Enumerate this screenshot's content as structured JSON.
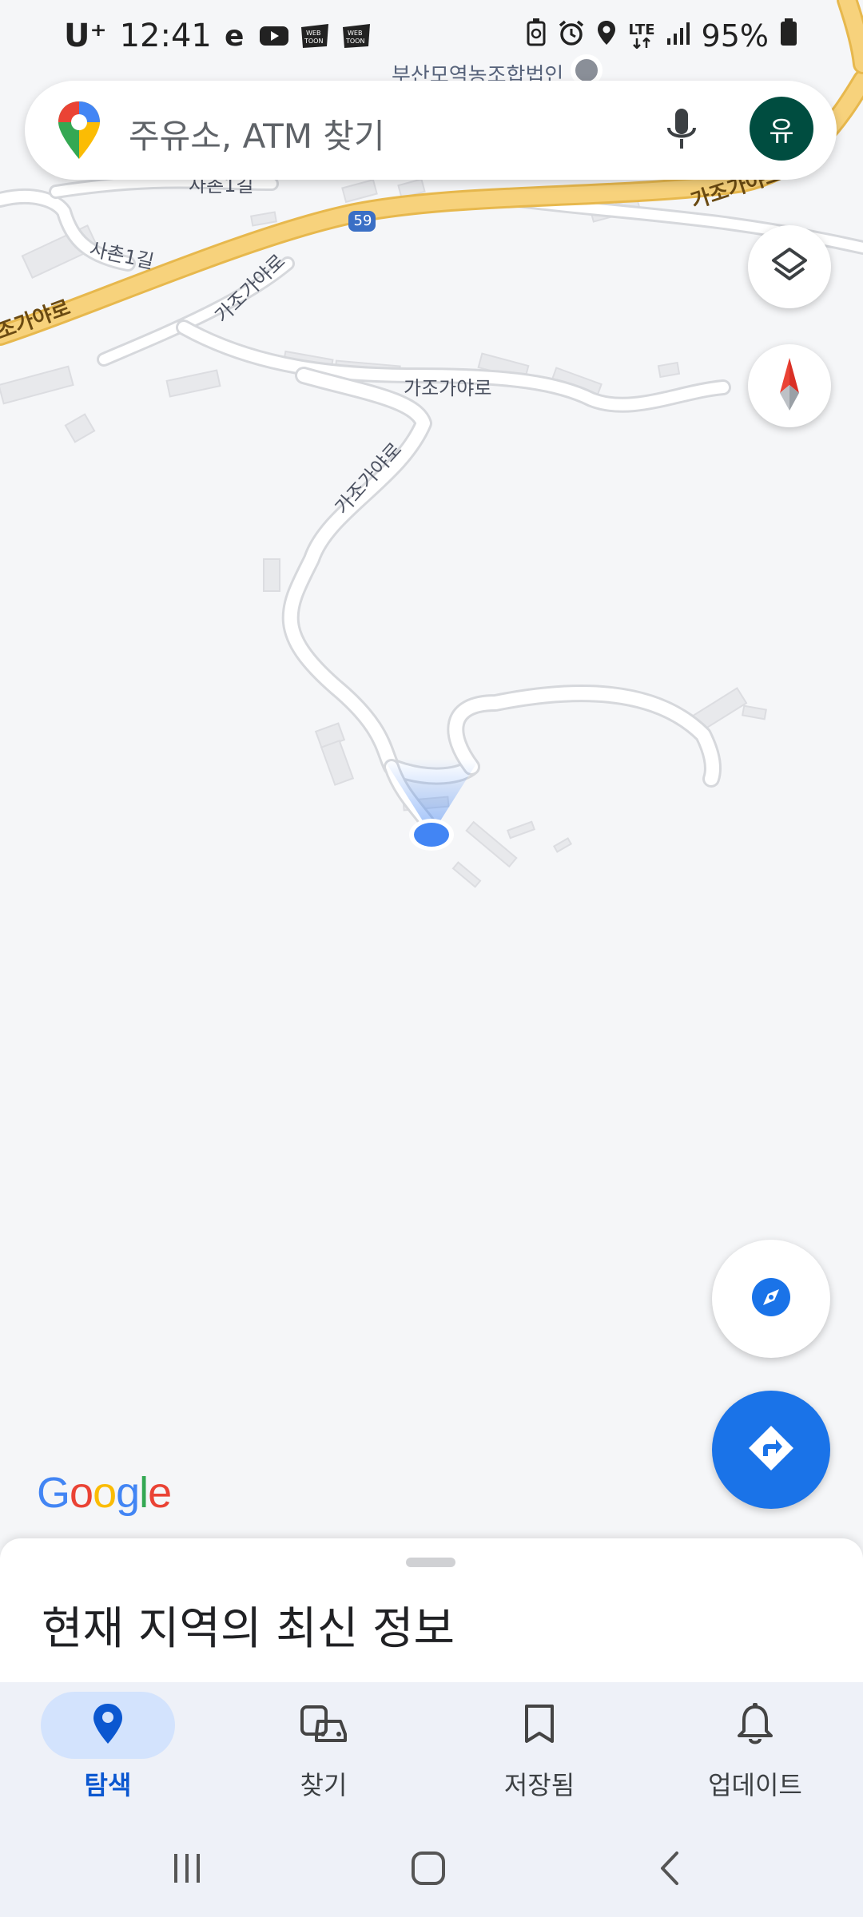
{
  "status_bar": {
    "carrier": "U⁺",
    "time": "12:41",
    "app_icons": [
      "e-app-icon",
      "youtube-icon",
      "webtoon-icon",
      "webtoon-icon"
    ],
    "right_icons": [
      "battery-saver-icon",
      "alarm-icon",
      "location-icon",
      "lte-icon",
      "signal-icon"
    ],
    "lte": "LTE",
    "battery": "95%"
  },
  "map": {
    "top_poi_label": "부산모역농조합법인",
    "road_labels": {
      "road_main": "가조가야로",
      "road_main_left": "가조가야로",
      "route_number": "59",
      "sachon": "사촌1길",
      "sachon_top": "사촌1길",
      "gajo_a": "가조가야로",
      "gajo_b": "가조가야로",
      "gajo_c": "가조가야로"
    },
    "colors": {
      "highway": "#f7d27c",
      "highway_edge": "#e7b84d",
      "road": "#ffffff",
      "user_dot": "#4285f4"
    }
  },
  "search": {
    "placeholder": "주유소, ATM 찾기",
    "avatar_initial": "유"
  },
  "google_logo": [
    "G",
    "o",
    "o",
    "g",
    "l",
    "e"
  ],
  "sheet": {
    "title": "현재 지역의 최신 정보"
  },
  "bottom_nav": {
    "items": [
      {
        "label": "탐색",
        "icon": "explore-pin-icon",
        "active": true
      },
      {
        "label": "찾기",
        "icon": "commute-icon",
        "active": false
      },
      {
        "label": "저장됨",
        "icon": "bookmark-icon",
        "active": false
      },
      {
        "label": "업데이트",
        "icon": "bell-icon",
        "active": false
      }
    ]
  },
  "colors": {
    "accent": "#1a73e8",
    "active_pill": "#d3e3fd",
    "avatar_bg": "#004d40"
  }
}
